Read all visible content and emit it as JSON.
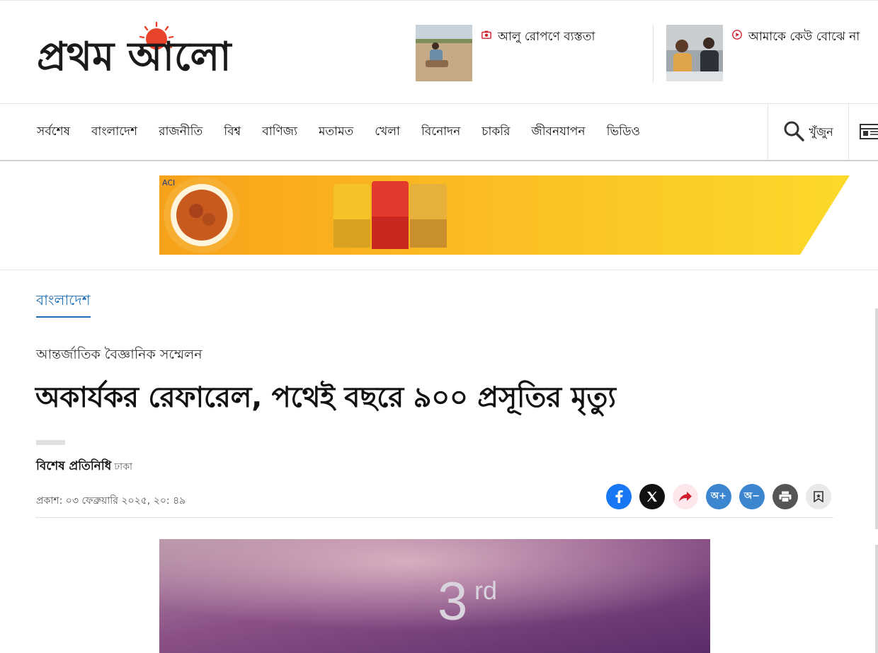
{
  "header": {
    "logo_text": "প্রথম আলো",
    "features": [
      {
        "title": "আলু রোপণে ব্যস্ততা",
        "icon": "camera-icon"
      },
      {
        "title": "আমাকে কেউ বোঝে না",
        "icon": "play-icon"
      }
    ]
  },
  "nav": {
    "items": [
      "সর্বশেষ",
      "বাংলাদেশ",
      "রাজনীতি",
      "বিশ্ব",
      "বাণিজ্য",
      "মতামত",
      "খেলা",
      "বিনোদন",
      "চাকরি",
      "জীবনযাপন",
      "ভিডিও"
    ],
    "search_label": "খুঁজুন"
  },
  "article": {
    "section": "বাংলাদেশ",
    "shoulder": "আন্তর্জাতিক বৈজ্ঞানিক সম্মেলন",
    "headline": "অকার্যকর রেফারেল, পথেই বছরে ৯০০ প্রসূতির মৃত্যু",
    "author": "বিশেষ প্রতিনিধি",
    "location": "ঢাকা",
    "published": "প্রকাশ: ০৩ ফেব্রুয়ারি ২০২৫, ২০: ৪৯",
    "font_up_label": "অ+",
    "font_down_label": "অ−",
    "hero_number": "3",
    "hero_suffix": "rd"
  },
  "colors": {
    "accent_blue": "#1c6fb8",
    "facebook": "#1877f2",
    "twitter": "#111111",
    "share_bg": "#fde7ea",
    "font_btn": "#3b86cf",
    "print_btn": "#555555"
  }
}
